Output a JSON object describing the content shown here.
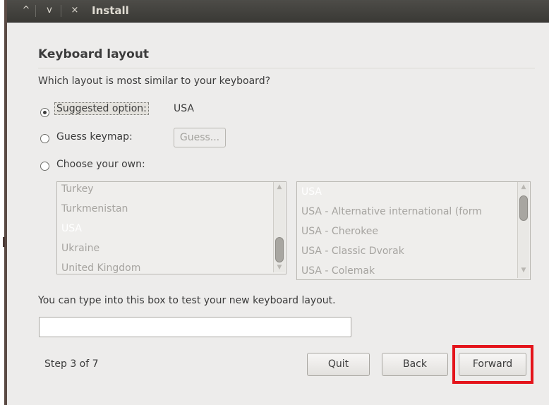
{
  "window": {
    "title": "Install",
    "controls": [
      "^",
      "v",
      "×"
    ]
  },
  "page": {
    "heading": "Keyboard layout",
    "question": "Which layout is most similar to your keyboard?"
  },
  "options": {
    "suggested_label": "Suggested option:",
    "suggested_value": "USA",
    "guess_label": "Guess keymap:",
    "guess_button": "Guess...",
    "choose_label": "Choose your own:"
  },
  "country_list": {
    "items": [
      "Turkey",
      "Turkmenistan",
      "USA",
      "Ukraine",
      "United Kingdom"
    ],
    "selected": "USA"
  },
  "variant_list": {
    "items": [
      "USA",
      "USA - Alternative international (form",
      "USA - Cherokee",
      "USA - Classic Dvorak",
      "USA - Colemak"
    ],
    "selected": "USA"
  },
  "test": {
    "label": "You can type into this box to test your new keyboard layout.",
    "value": ""
  },
  "footer": {
    "step": "Step 3 of 7",
    "quit": "Quit",
    "back": "Back",
    "forward": "Forward"
  },
  "colors": {
    "background": "#edeceb",
    "titlebar": "#3c3b37",
    "selected_item": "#ffffff",
    "disabled_text": "#a6a4a0",
    "highlight": "#e4141b"
  }
}
